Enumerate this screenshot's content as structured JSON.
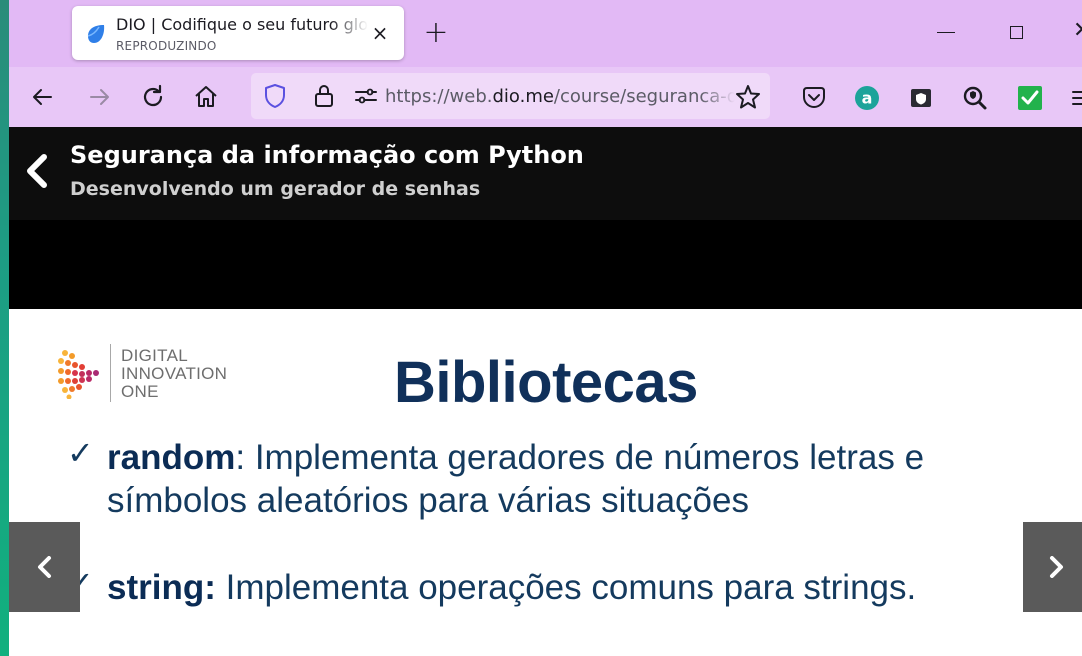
{
  "browser": {
    "tab": {
      "title": "DIO | Codifique o seu futuro global agora",
      "subtitle": "REPRODUZINDO",
      "close_glyph": "×"
    },
    "new_tab_glyph": "+",
    "window_close_glyph": "✕",
    "url": {
      "prefix": "https://web.",
      "domain": "dio.me",
      "path": "/course/seguranca-da-informacao-com-python"
    },
    "icons": [
      "back-icon",
      "forward-icon",
      "reload-icon",
      "home-icon",
      "shield-icon",
      "lock-icon",
      "permissions-icon",
      "bookmark-star-icon",
      "pocket-icon",
      "amazon-assistant-icon",
      "extension-shield-icon",
      "privacy-search-icon",
      "checkmark-extension-icon",
      "menu-icon"
    ],
    "theme_color": "#e2b9f5"
  },
  "course": {
    "title": "Segurança da informação com Python",
    "lesson": "Desenvolvendo um gerador de senhas"
  },
  "slide": {
    "logo_lines": [
      "DIGITAL",
      "INNOVATION",
      "ONE"
    ],
    "heading": "Bibliotecas",
    "bullets": [
      {
        "term": "random",
        "separator": ":",
        "line1": " Implementa geradores de números letras e",
        "line2": "símbolos aleatórios para várias situações"
      },
      {
        "term": "string:",
        "line1": " Implementa operações comuns para strings."
      }
    ],
    "check_glyph": "✓",
    "accent_color": "#10305a"
  }
}
